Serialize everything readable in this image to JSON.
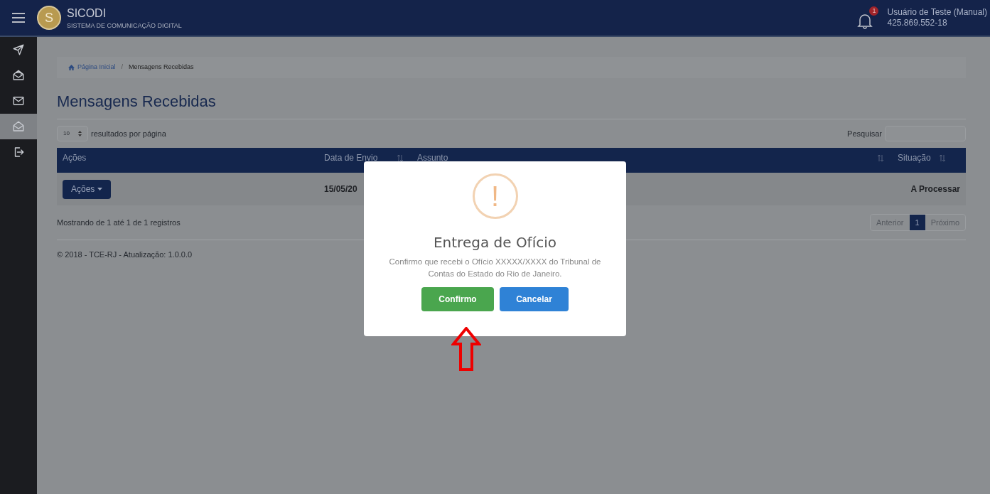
{
  "header": {
    "app_name": "SICODI",
    "app_subtitle": "SISTEMA DE COMUNICAÇÃO DIGITAL",
    "logo_letter": "S",
    "notification_count": "1",
    "user_name": "Usuário de Teste (Manual)",
    "user_id": "425.869.552-18"
  },
  "sidebar": {
    "items": [
      {
        "kind": "send",
        "selected": false
      },
      {
        "kind": "inbox-open",
        "selected": false
      },
      {
        "kind": "mail",
        "selected": false
      },
      {
        "kind": "inbox",
        "selected": true
      },
      {
        "kind": "logout",
        "selected": false
      }
    ]
  },
  "breadcrumb": [
    {
      "label": "Página Inicial",
      "kind": "link"
    },
    {
      "label": "/",
      "kind": "separator"
    },
    {
      "label": "Mensagens Recebidas",
      "kind": "current"
    }
  ],
  "page_title": "Mensagens Recebidas",
  "page_size": {
    "value": "10",
    "label": "resultados por página"
  },
  "search": {
    "label": "Pesquisar"
  },
  "table": {
    "columns": [
      {
        "label": "Ações",
        "sortable": false
      },
      {
        "label": "Data de Envio",
        "sortable": true
      },
      {
        "label": "Assunto",
        "sortable": true
      },
      {
        "label": "Situação",
        "sortable": true
      }
    ],
    "rows": [
      {
        "action": "Ações",
        "date": "15/05/20",
        "status": "A Processar"
      }
    ]
  },
  "table_info": "Mostrando de 1 até 1 de 1 registros",
  "pagination": [
    {
      "label": "Anterior",
      "selected": false
    },
    {
      "label": "1",
      "selected": true
    },
    {
      "label": "Próximo",
      "selected": false
    }
  ],
  "footer": "© 2018 - TCE-RJ - Atualização: 1.0.0.0",
  "dialog": {
    "icon": "!",
    "title": "Entrega de Ofício",
    "message": "Confirmo que recebi o Ofício XXXXX/XXXX do Tribunal de Contas do Estado do Rio de Janeiro.",
    "buttons": [
      {
        "label": "Confirmo",
        "kind": "confirm"
      },
      {
        "label": "Cancelar",
        "kind": "cancel"
      }
    ]
  },
  "annotation": {
    "pointer": true
  }
}
